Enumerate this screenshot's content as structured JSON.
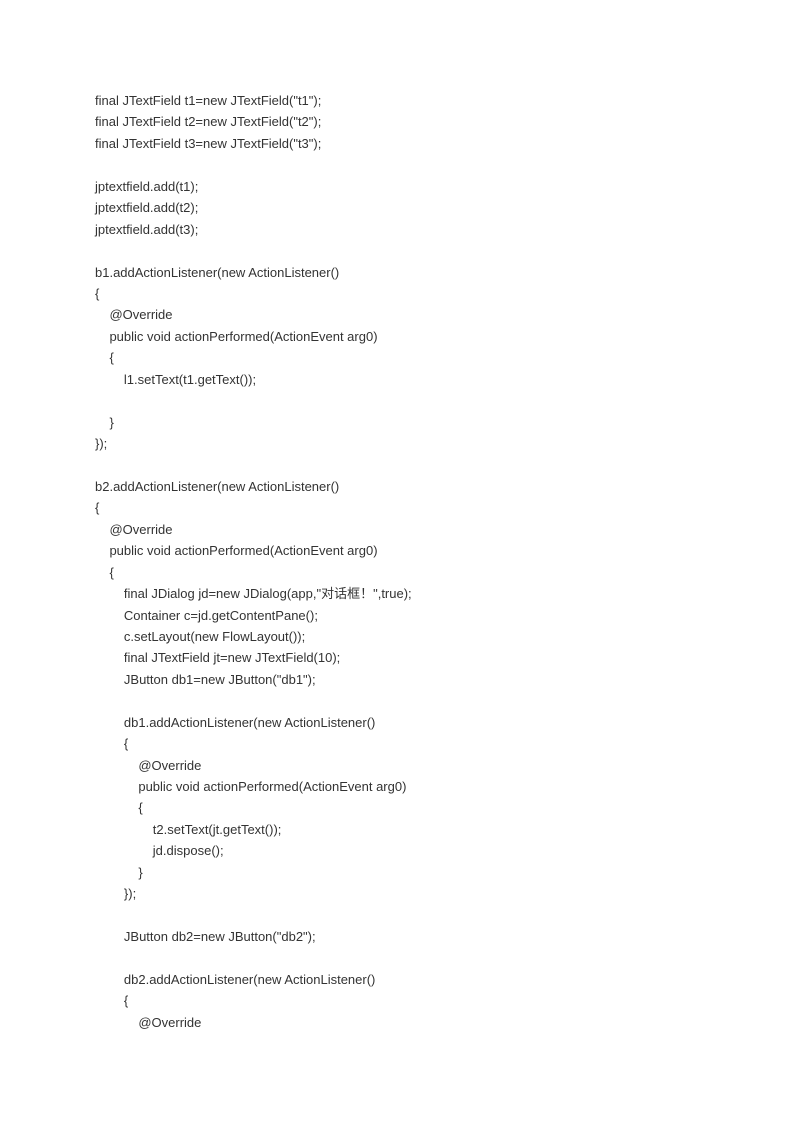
{
  "code": {
    "lines": [
      "final JTextField t1=new JTextField(\"t1\");",
      "final JTextField t2=new JTextField(\"t2\");",
      "final JTextField t3=new JTextField(\"t3\");",
      "",
      "jptextfield.add(t1);",
      "jptextfield.add(t2);",
      "jptextfield.add(t3);",
      "",
      "b1.addActionListener(new ActionListener()",
      "{",
      "    @Override",
      "    public void actionPerformed(ActionEvent arg0)",
      "    {",
      "        l1.setText(t1.getText());",
      "",
      "    }",
      "});",
      "",
      "b2.addActionListener(new ActionListener()",
      "{",
      "    @Override",
      "    public void actionPerformed(ActionEvent arg0)",
      "    {",
      "        final JDialog jd=new JDialog(app,\"对话框！\",true);",
      "        Container c=jd.getContentPane();",
      "        c.setLayout(new FlowLayout());",
      "        final JTextField jt=new JTextField(10);",
      "        JButton db1=new JButton(\"db1\");",
      "",
      "        db1.addActionListener(new ActionListener()",
      "        {",
      "            @Override",
      "            public void actionPerformed(ActionEvent arg0)",
      "            {",
      "                t2.setText(jt.getText());",
      "                jd.dispose();",
      "            }",
      "        });",
      "",
      "        JButton db2=new JButton(\"db2\");",
      "",
      "        db2.addActionListener(new ActionListener()",
      "        {",
      "            @Override"
    ]
  }
}
